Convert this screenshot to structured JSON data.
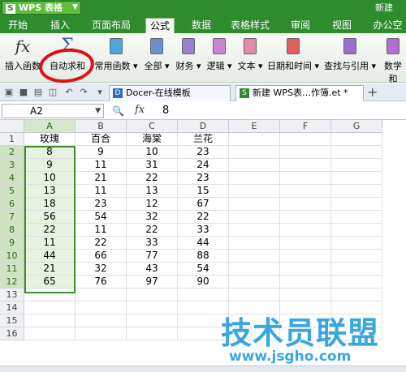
{
  "titlebar": {
    "app_name": "WPS 表格",
    "app_logo": "S",
    "new_label": "新建"
  },
  "menu_tabs": [
    "开始",
    "插入",
    "页面布局",
    "公式",
    "数据",
    "表格样式",
    "审阅",
    "视图",
    "办公空间"
  ],
  "active_tab": "公式",
  "ribbon": {
    "insert_function": "插入函数",
    "autosum": "自动求和",
    "common_functions": "常用函数",
    "all": "全部",
    "finance": "财务",
    "logic": "逻辑",
    "text": "文本",
    "datetime": "日期和时间",
    "lookup": "查找与引用",
    "math": "数学和"
  },
  "quick_toolbar": [
    "open-icon",
    "save-icon",
    "print-icon",
    "preview-icon",
    "undo-icon",
    "redo-icon"
  ],
  "doc_tabs": [
    {
      "label": "Docer-在线模板",
      "active": false
    },
    {
      "label": "新建 WPS表…作簿.et *",
      "active": true
    }
  ],
  "formula_bar": {
    "name_box": "A2",
    "fx": "fx",
    "value": "8"
  },
  "columns": [
    "A",
    "B",
    "C",
    "D",
    "E",
    "F",
    "G"
  ],
  "rows": [
    "1",
    "2",
    "3",
    "4",
    "5",
    "6",
    "7",
    "8",
    "9",
    "10",
    "11",
    "12",
    "13",
    "14",
    "15",
    "16"
  ],
  "sheet": [
    [
      "玫瑰",
      "百合",
      "海棠",
      "兰花"
    ],
    [
      "8",
      "9",
      "10",
      "23"
    ],
    [
      "9",
      "11",
      "31",
      "24"
    ],
    [
      "10",
      "21",
      "22",
      "23"
    ],
    [
      "13",
      "11",
      "13",
      "15"
    ],
    [
      "18",
      "23",
      "12",
      "67"
    ],
    [
      "56",
      "54",
      "32",
      "22"
    ],
    [
      "22",
      "11",
      "22",
      "33"
    ],
    [
      "11",
      "22",
      "33",
      "44"
    ],
    [
      "44",
      "66",
      "77",
      "88"
    ],
    [
      "21",
      "32",
      "43",
      "54"
    ],
    [
      "65",
      "76",
      "97",
      "90"
    ]
  ],
  "watermark": {
    "title": "技术员联盟",
    "url": "www.jsgho.com"
  },
  "colors": {
    "title_green": "#2e8b2e",
    "selection_green": "#3d8f2a",
    "annotation_red": "#e01010",
    "watermark_blue": "#3aa6e0"
  }
}
